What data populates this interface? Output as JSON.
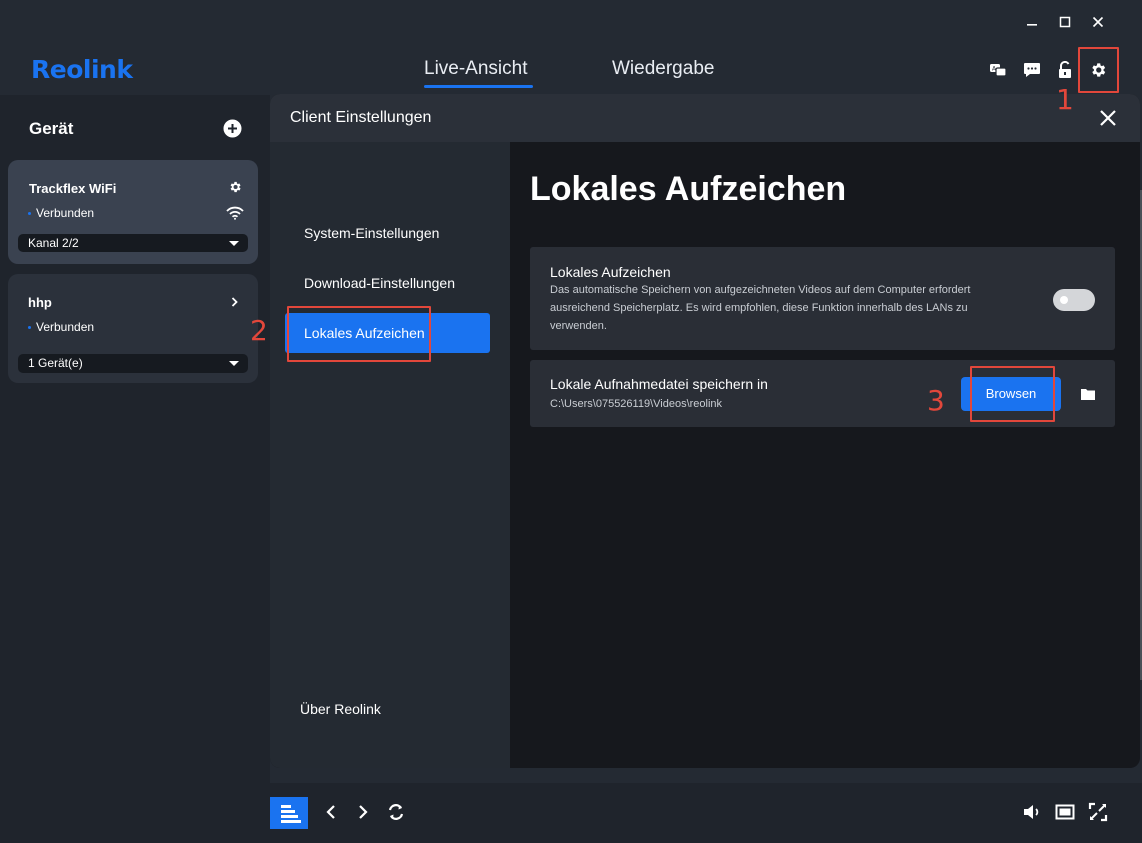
{
  "app": {
    "brand": "Reolink",
    "tabs": [
      {
        "label": "Live-Ansicht",
        "active": true
      },
      {
        "label": "Wiedergabe",
        "active": false
      }
    ],
    "header_icons": [
      "language-switch-icon",
      "feedback-icon",
      "lock-icon",
      "settings-gear-icon"
    ],
    "window_controls": [
      "minimize-icon",
      "maximize-icon",
      "close-icon"
    ]
  },
  "sidebar": {
    "title": "Gerät",
    "devices": [
      {
        "name": "Trackflex WiFi",
        "status": "Verbunden",
        "select_value": "Kanal 2/2"
      },
      {
        "name": "hhp",
        "status": "Verbunden",
        "select_value": "1 Gerät(e)"
      }
    ]
  },
  "dialog": {
    "title": "Client Einstellungen",
    "nav": {
      "items": [
        {
          "label": "System-Einstellungen",
          "active": false
        },
        {
          "label": "Download-Einstellungen",
          "active": false
        },
        {
          "label": "Lokales Aufzeichen",
          "active": true
        }
      ],
      "about": "Über Reolink"
    },
    "content": {
      "title": "Lokales Aufzeichen",
      "record_setting": {
        "title": "Lokales Aufzeichen",
        "description": "Das automatische Speichern von aufgezeichneten Videos auf dem Computer erfordert ausreichend Speicherplatz. Es wird empfohlen, diese Funktion innerhalb des LANs zu verwenden.",
        "enabled": false
      },
      "save_path": {
        "title": "Lokale Aufnahmedatei speichern in",
        "path": "C:\\Users\\075526119\\Videos\\reolink",
        "browse_label": "Browsen"
      }
    }
  },
  "annotations": [
    "1",
    "2",
    "3"
  ],
  "colors": {
    "accent": "#1a73f0",
    "annotation": "#e2473b",
    "background": "#242a33",
    "dialog_bg": "#16181d"
  }
}
